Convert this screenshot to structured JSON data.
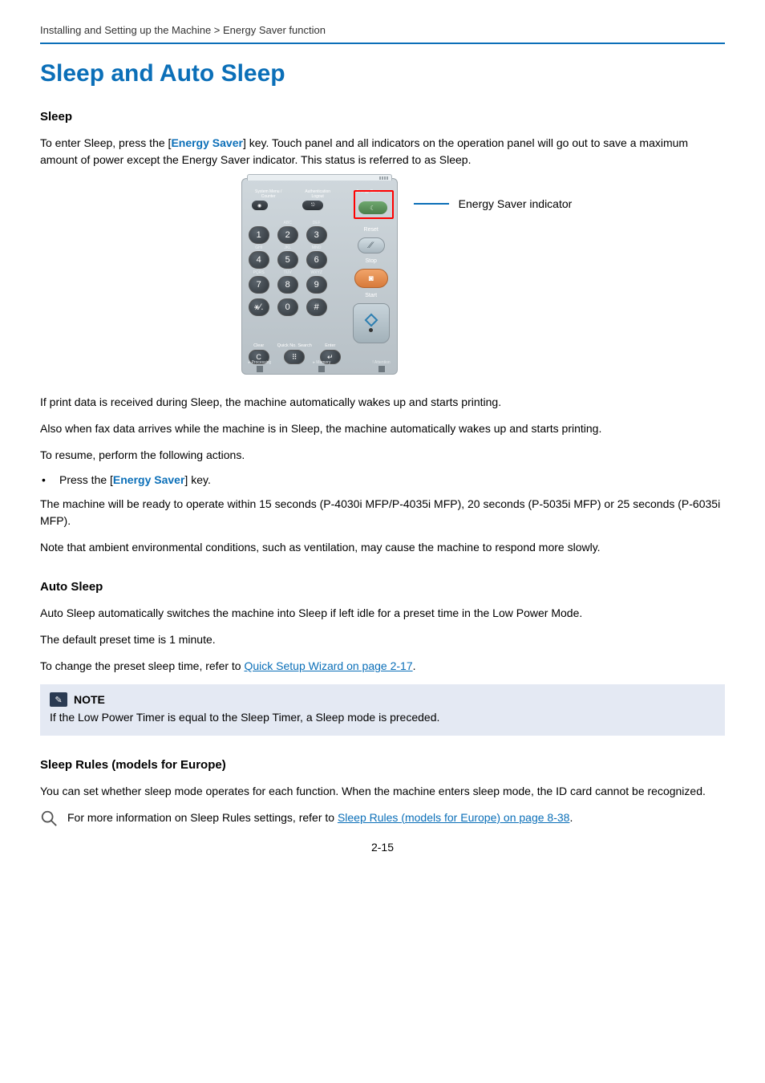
{
  "breadcrumb": "Installing and Setting up the Machine > Energy Saver function",
  "title": "Sleep and Auto Sleep",
  "sections": {
    "sleep": {
      "heading": "Sleep",
      "intro_pre": "To enter Sleep, press the [",
      "intro_key": "Energy Saver",
      "intro_post": "] key. Touch panel and all indicators on the operation panel will go out to save a maximum amount of power except the Energy Saver indicator. This status is referred to as Sleep.",
      "callout": "Energy Saver indicator",
      "p1": "If print data is received during Sleep, the machine automatically wakes up and starts printing.",
      "p2": "Also when fax data arrives while the machine is in Sleep, the machine automatically wakes up and starts printing.",
      "p3": "To resume, perform the following actions.",
      "bullet_pre": "Press the [",
      "bullet_key": "Energy Saver",
      "bullet_post": "] key.",
      "p4": "The machine will be ready to operate within 15 seconds (P-4030i MFP/P-4035i MFP), 20 seconds (P-5035i MFP) or 25 seconds (P-6035i MFP).",
      "p5": "Note that ambient environmental conditions, such as ventilation, may cause the machine to respond more slowly."
    },
    "auto_sleep": {
      "heading": "Auto Sleep",
      "p1": "Auto Sleep automatically switches the machine into Sleep if left idle for a preset time in the Low Power Mode.",
      "p2": "The default preset time is 1 minute.",
      "p3_pre": "To change the preset sleep time, refer to ",
      "p3_link": "Quick Setup Wizard on page 2-17",
      "p3_post": "."
    },
    "note": {
      "label": "NOTE",
      "body": "If the Low Power Timer is equal to the Sleep Timer, a Sleep mode is preceded."
    },
    "rules": {
      "heading": "Sleep Rules (models for Europe)",
      "p1": "You can set whether sleep mode operates for each function. When the machine enters sleep mode, the ID card cannot be recognized.",
      "p2_pre": "For more information on Sleep Rules settings, refer to ",
      "p2_link": "Sleep Rules (models for Europe) on page 8-38",
      "p2_post": "."
    }
  },
  "panel": {
    "sys_menu": "System Menu / Counter",
    "auth": "Authentication Logout",
    "energy_saver": "Energy Saver",
    "reset": "Reset",
    "stop": "Stop",
    "start": "Start",
    "clear": "Clear",
    "quick": "Quick No. Search",
    "enter": "Enter",
    "letters": {
      "abc": "ABC",
      "def": "DEF",
      "ghi": "GHI",
      "jkl": "JKL",
      "mno": "MNO",
      "pqrs": "PQRS",
      "tuv": "TUV",
      "wxyz": "WXYZ"
    },
    "nums": {
      "1": "1",
      "2": "2",
      "3": "3",
      "4": "4",
      "5": "5",
      "6": "6",
      "7": "7",
      "8": "8",
      "9": "9",
      "0": "0",
      "star": "⚹⁄.",
      "hash": "#"
    },
    "status": {
      "processing": "Processing",
      "memory": "Memory",
      "attention": "Attention"
    }
  },
  "page_number": "2-15"
}
